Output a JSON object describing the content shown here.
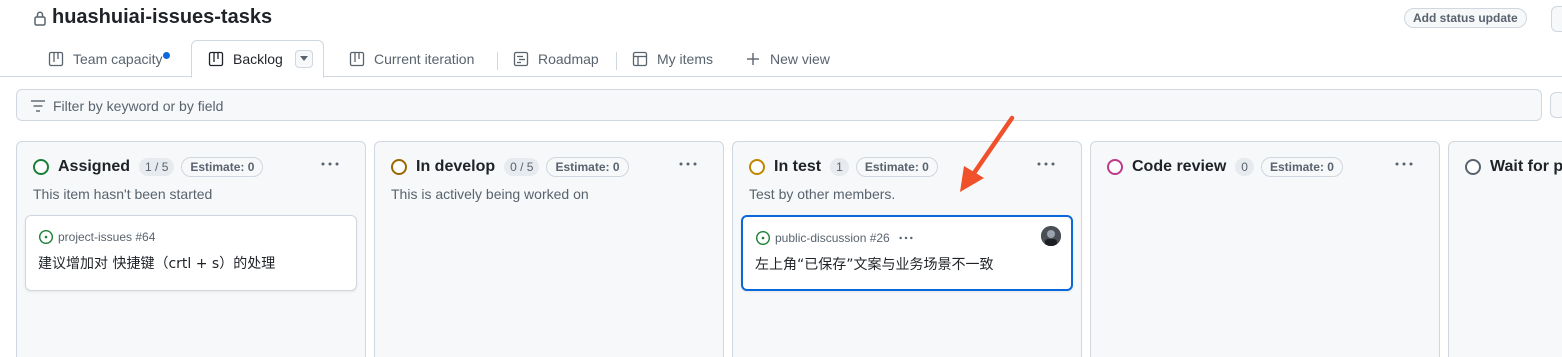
{
  "header": {
    "title": "huashuiai-issues-tasks",
    "status_button": "Add status update"
  },
  "tabs": [
    {
      "label": "Team capacity",
      "icon": "board-icon",
      "active": false,
      "has_notification": true
    },
    {
      "label": "Backlog",
      "icon": "board-icon",
      "active": true
    },
    {
      "label": "Current iteration",
      "icon": "board-icon",
      "active": false
    },
    {
      "label": "Roadmap",
      "icon": "roadmap-icon",
      "active": false
    },
    {
      "label": "My items",
      "icon": "table-icon",
      "active": false
    },
    {
      "label": "New view",
      "icon": "plus-icon",
      "active": false
    }
  ],
  "filter": {
    "placeholder": "Filter by keyword or by field"
  },
  "columns": [
    {
      "title": "Assigned",
      "count": "1 / 5",
      "estimate": "Estimate: 0",
      "description": "This item hasn't been started",
      "status_color": "#1a7f37",
      "cards": [
        {
          "repo_ref": "project-issues #64",
          "title": "建议增加对 快捷键（crtl + s）的处理",
          "selected": false
        }
      ]
    },
    {
      "title": "In develop",
      "count": "0 / 5",
      "estimate": "Estimate: 0",
      "description": "This is actively being worked on",
      "status_color": "#9a6700",
      "cards": []
    },
    {
      "title": "In test",
      "count": "1",
      "estimate": "Estimate: 0",
      "description": "Test by other members.",
      "status_color": "#bf8700",
      "cards": [
        {
          "repo_ref": "public-discussion #26",
          "title": "左上角“已保存”文案与业务场景不一致",
          "selected": true
        }
      ]
    },
    {
      "title": "Code review",
      "count": "0",
      "estimate": "Estimate: 0",
      "description": "",
      "status_color": "#bf3989",
      "cards": []
    },
    {
      "title": "Wait for p",
      "status_color": "#59636e"
    }
  ],
  "colors": {
    "accent": "#0969da",
    "annotation_arrow": "#f0502a"
  }
}
